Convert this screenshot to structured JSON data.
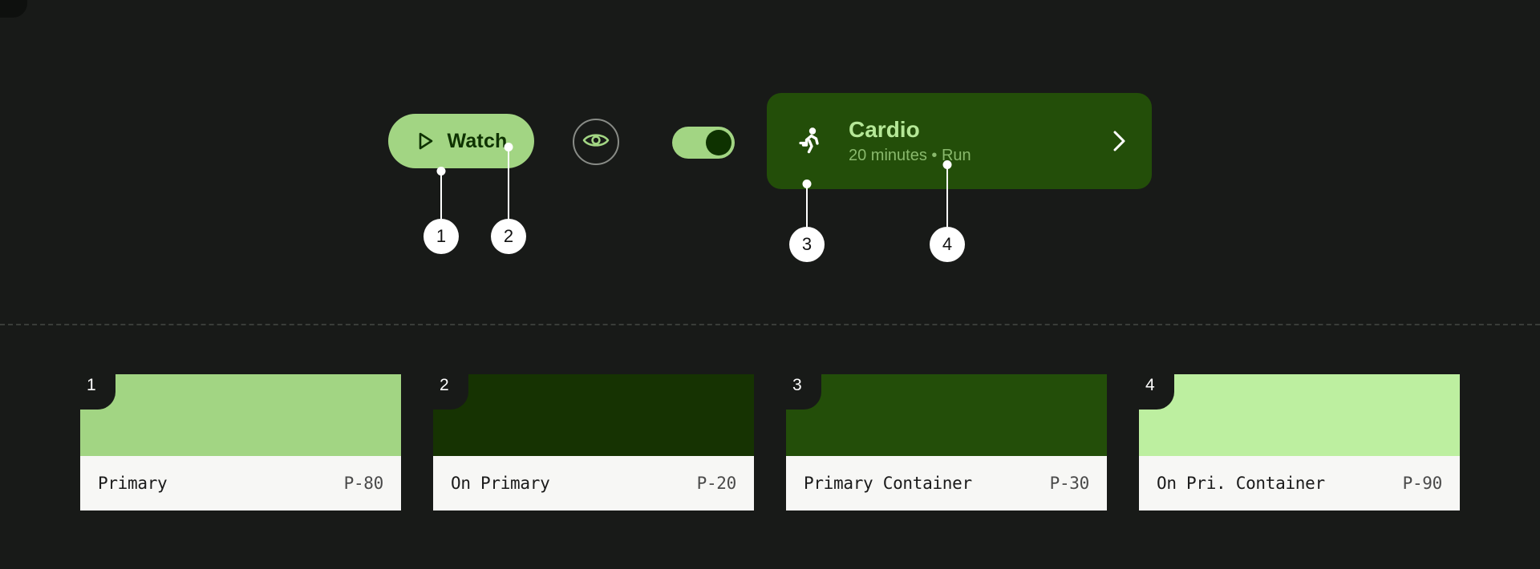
{
  "canvas": {
    "background": "#181A18",
    "divider_color": "#3A3D39"
  },
  "showcase": {
    "watch_button": {
      "label": "Watch",
      "icon": "play-triangle-icon",
      "background": "#A2D583",
      "foreground": "#0E3200"
    },
    "visibility_toggle_icon": {
      "icon": "eye-icon",
      "ring_color": "#888B86",
      "icon_color": "#A2D583"
    },
    "switch": {
      "state": "on",
      "track_color": "#A2D583",
      "knob_color": "#0E3200"
    },
    "cardio_card": {
      "title": "Cardio",
      "subtitle": "20 minutes • Run",
      "leading_icon": "running-person-icon",
      "trailing_icon": "chevron-right-icon",
      "background": "#234E09",
      "title_color": "#B5E797",
      "subtitle_color": "#89B96C"
    }
  },
  "callouts": [
    {
      "number": "1",
      "target": "watch-button-background"
    },
    {
      "number": "2",
      "target": "watch-button-label"
    },
    {
      "number": "3",
      "target": "cardio-card-background"
    },
    {
      "number": "4",
      "target": "cardio-card-subtitle"
    }
  ],
  "swatches": [
    {
      "number": "1",
      "name": "Primary",
      "token": "P-80",
      "color": "#A2D583"
    },
    {
      "number": "2",
      "name": "On Primary",
      "token": "P-20",
      "color": "#163302"
    },
    {
      "number": "3",
      "name": "Primary Container",
      "token": "P-30",
      "color": "#234E09"
    },
    {
      "number": "4",
      "name": "On Pri. Container",
      "token": "P-90",
      "color": "#BDEFA0"
    }
  ]
}
